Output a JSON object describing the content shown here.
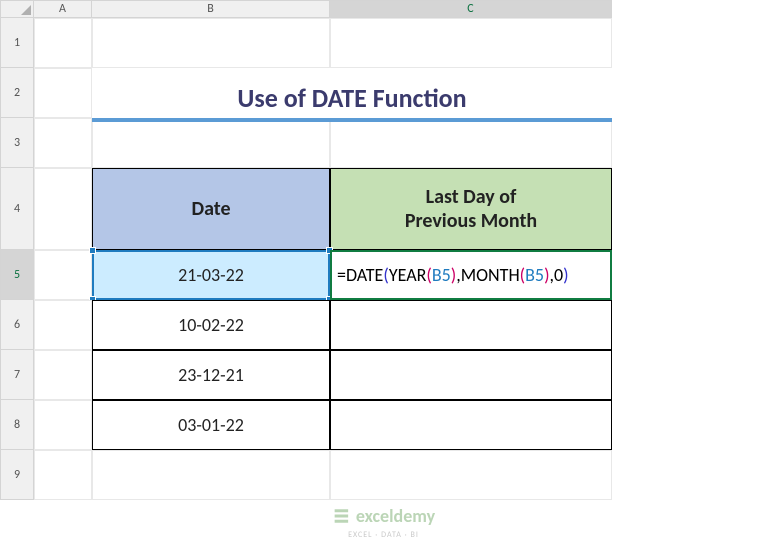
{
  "columns": [
    "A",
    "B",
    "C"
  ],
  "rows": [
    "1",
    "2",
    "3",
    "4",
    "5",
    "6",
    "7",
    "8",
    "9"
  ],
  "title": "Use of DATE Function",
  "headers": {
    "date": "Date",
    "last_line1": "Last Day of",
    "last_line2": "Previous Month"
  },
  "data": {
    "b5": "21-03-22",
    "b6": "10-02-22",
    "b7": "23-12-21",
    "b8": "03-01-22"
  },
  "formula": {
    "eq": "=",
    "date": "DATE",
    "year": "YEAR",
    "month": "MONTH",
    "ref": "B5",
    "zero": ",0"
  },
  "watermark": {
    "brand": "exceldemy",
    "sub": "EXCEL · DATA · BI"
  },
  "active_row": "5",
  "active_col": "C",
  "chart_data": {
    "type": "table",
    "title": "Use of DATE Function",
    "columns": [
      "Date",
      "Last Day of Previous Month"
    ],
    "rows": [
      [
        "21-03-22",
        "=DATE(YEAR(B5),MONTH(B5),0)"
      ],
      [
        "10-02-22",
        ""
      ],
      [
        "23-12-21",
        ""
      ],
      [
        "03-01-22",
        ""
      ]
    ]
  }
}
